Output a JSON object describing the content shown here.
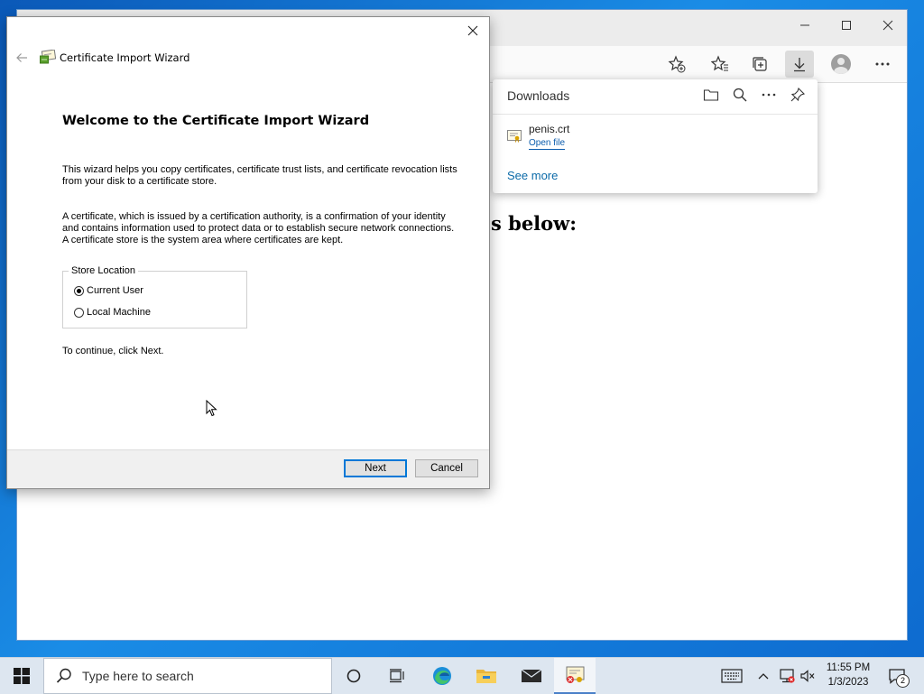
{
  "browser": {
    "page_heading": "s below:",
    "toolbar_icons": [
      "add-favorite-icon",
      "favorites-icon",
      "collections-icon",
      "downloads-icon",
      "profile-icon",
      "more-icon"
    ]
  },
  "downloads": {
    "title": "Downloads",
    "file_name": "penis.crt",
    "open_file": "Open file",
    "see_more": "See more"
  },
  "wizard": {
    "window_title": "Certificate Import Wizard",
    "heading": "Welcome to the Certificate Import Wizard",
    "paragraph1": "This wizard helps you copy certificates, certificate trust lists, and certificate revocation lists from your disk to a certificate store.",
    "paragraph2": "A certificate, which is issued by a certification authority, is a confirmation of your identity and contains information used to protect data or to establish secure network connections. A certificate store is the system area where certificates are kept.",
    "store_location": {
      "legend": "Store Location",
      "options": [
        {
          "label": "Current User",
          "selected": true
        },
        {
          "label": "Local Machine",
          "selected": false
        }
      ]
    },
    "continue_text": "To continue, click Next.",
    "next_label": "Next",
    "cancel_label": "Cancel"
  },
  "taskbar": {
    "search_placeholder": "Type here to search",
    "time": "11:55 PM",
    "date": "1/3/2023",
    "notification_count": "2"
  },
  "colors": {
    "accent": "#0078d7",
    "link": "#0b6aa8",
    "desktop": "#0e6bcf"
  }
}
